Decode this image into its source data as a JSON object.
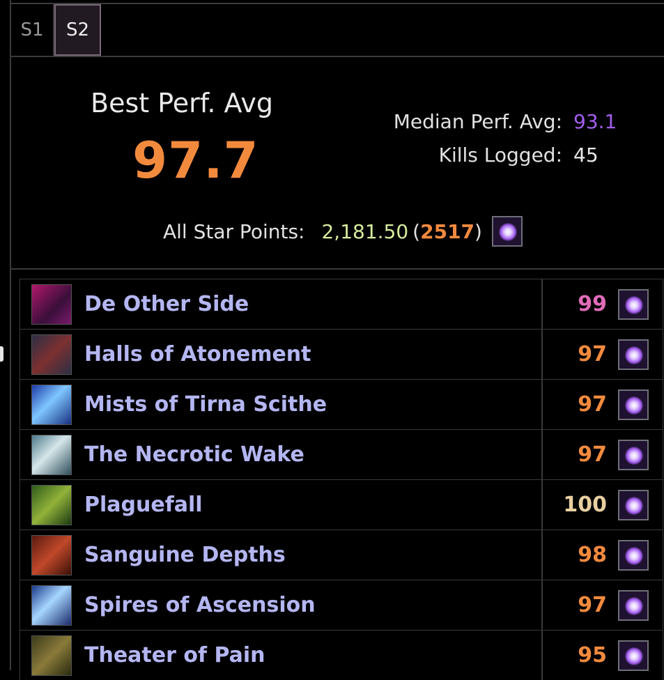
{
  "tabs": [
    {
      "label": "S1",
      "active": false
    },
    {
      "label": "S2",
      "active": true
    }
  ],
  "summary": {
    "best_label": "Best Perf. Avg",
    "best_value": "97.7",
    "median_label": "Median Perf. Avg:",
    "median_value": "93.1",
    "kills_label": "Kills Logged:",
    "kills_value": "45",
    "star_label": "All Star Points:",
    "star_points": "2,181.50",
    "star_open": "(",
    "star_rank": "2517",
    "star_close": ")"
  },
  "colors": {
    "accent_orange": "#f28a3e",
    "median_purple": "#a35ef0",
    "dungeon_name": "#b4b6f2",
    "star_points_green": "#d6ec9e"
  },
  "dungeons": [
    {
      "name": "De Other Side",
      "score": "99",
      "tone": "pink",
      "thumb": "dos"
    },
    {
      "name": "Halls of Atonement",
      "score": "97",
      "tone": "orange",
      "thumb": "hoa"
    },
    {
      "name": "Mists of Tirna Scithe",
      "score": "97",
      "tone": "orange",
      "thumb": "mots"
    },
    {
      "name": "The Necrotic Wake",
      "score": "97",
      "tone": "orange",
      "thumb": "nw"
    },
    {
      "name": "Plaguefall",
      "score": "100",
      "tone": "gold",
      "thumb": "pf"
    },
    {
      "name": "Sanguine Depths",
      "score": "98",
      "tone": "orange",
      "thumb": "sd"
    },
    {
      "name": "Spires of Ascension",
      "score": "97",
      "tone": "orange",
      "thumb": "soa"
    },
    {
      "name": "Theater of Pain",
      "score": "95",
      "tone": "orange",
      "thumb": "top"
    }
  ],
  "icons": {
    "rank_icon": "star-rank-icon"
  }
}
